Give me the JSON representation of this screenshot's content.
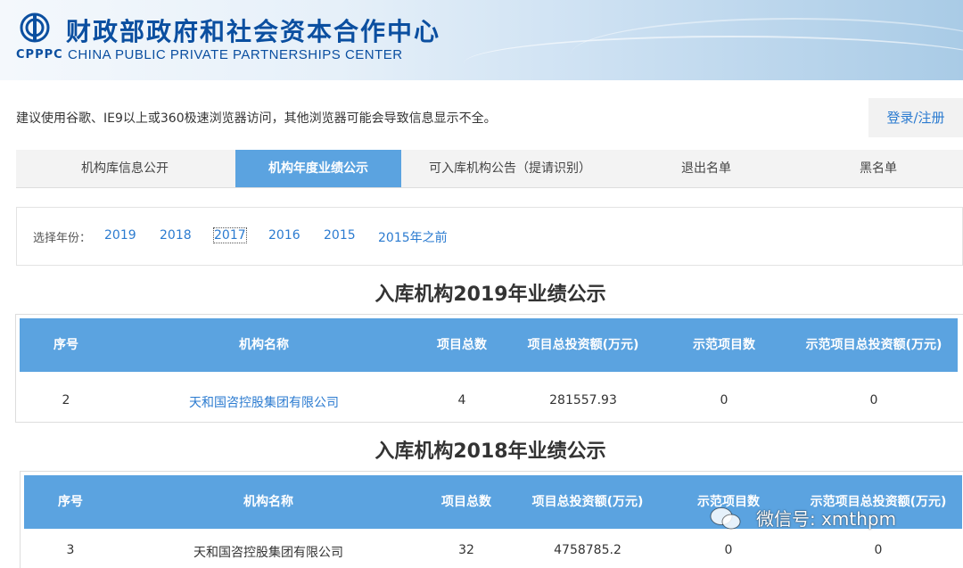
{
  "header": {
    "cn_title": "财政部政府和社会资本合作中心",
    "abbr": "CPPPC",
    "en_title": "CHINA PUBLIC PRIVATE PARTNERSHIPS CENTER",
    "brand_color": "#0b4fa0"
  },
  "notice": "建议使用谷歌、IE9以上或360极速浏览器访问，其他浏览器可能会导致信息显示不全。",
  "login_label": "登录/注册",
  "tabs": [
    {
      "label": "机构库信息公开",
      "active": false
    },
    {
      "label": "机构年度业绩公示",
      "active": true
    },
    {
      "label": "可入库机构公告（提请识别）",
      "active": false
    },
    {
      "label": "退出名单",
      "active": false
    },
    {
      "label": "黑名单",
      "active": false
    }
  ],
  "year_filter": {
    "label": "选择年份：",
    "years": [
      "2019",
      "2018",
      "2017",
      "2016",
      "2015",
      "2015年之前"
    ],
    "focused": "2017"
  },
  "columns": [
    "序号",
    "机构名称",
    "项目总数",
    "项目总投资额(万元)",
    "示范项目数",
    "示范项目总投资额(万元)"
  ],
  "sections": [
    {
      "title": "入库机构2019年业绩公示",
      "row": {
        "index": "2",
        "name": "天和国咨控股集团有限公司",
        "projects": "4",
        "investment": "281557.93",
        "demo_projects": "0",
        "demo_investment": "0"
      }
    },
    {
      "title": "入库机构2018年业绩公示",
      "row": {
        "index": "3",
        "name": "天和国咨控股集团有限公司",
        "projects": "32",
        "investment": "4758785.2",
        "demo_projects": "0",
        "demo_investment": "0"
      }
    }
  ],
  "watermark": "微信号: xmthpm",
  "colors": {
    "accent": "#5ba3e0",
    "link": "#2b7bd0"
  }
}
